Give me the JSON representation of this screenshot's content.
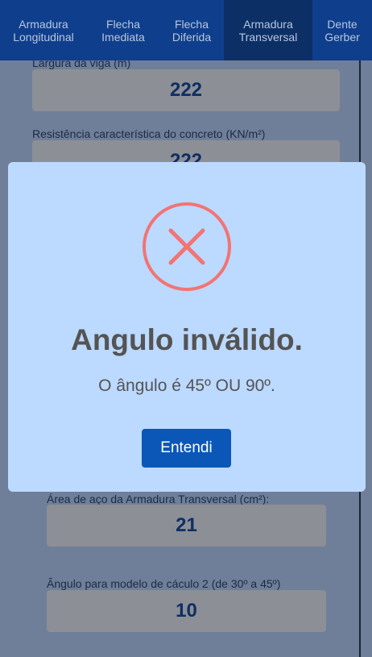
{
  "nav": {
    "tabs": [
      {
        "line1": "Armadura",
        "line2": "Longitudinal"
      },
      {
        "line1": "Flecha",
        "line2": "Imediata"
      },
      {
        "line1": "Flecha",
        "line2": "Diferida"
      },
      {
        "line1": "Armadura",
        "line2": "Transversal"
      },
      {
        "line1": "Dente",
        "line2": "Gerber"
      }
    ],
    "active_index": 3
  },
  "form": {
    "width_label": "Largura da viga (m)",
    "width_value": "222",
    "fck_label": "Resistência característica do concreto (KN/m²)",
    "fck_value": "222",
    "steel_area_label": "Área de aço da Armadura Transversal (cm²):",
    "steel_area_value": "21",
    "angle_label": "Ângulo para modelo de cáculo 2 (de 30º a 45º)",
    "angle_value": "10"
  },
  "modal": {
    "icon": "error-x-icon",
    "title": "Angulo inválido.",
    "message": "O ângulo é 45º OU 90º.",
    "button": "Entendi"
  },
  "colors": {
    "nav_bg": "#0f3f8c",
    "nav_active_bg": "#0c2f66",
    "modal_bg": "#bcd9ff",
    "error_red": "#f27474",
    "button_blue": "#0a57b8"
  }
}
